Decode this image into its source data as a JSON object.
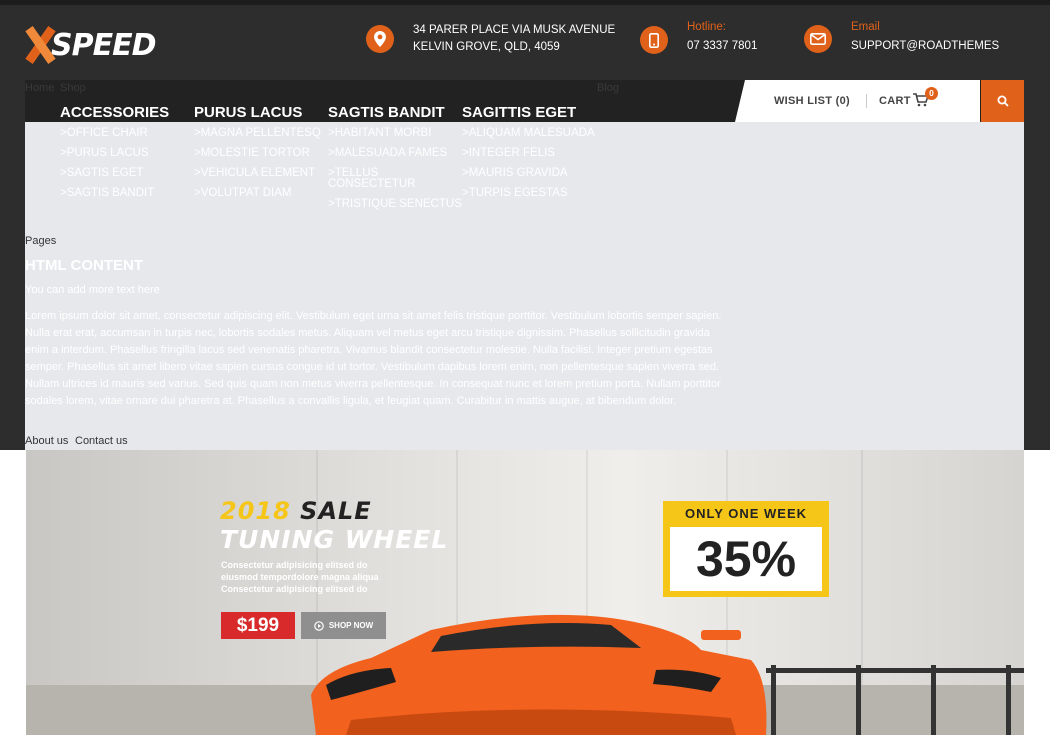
{
  "logo": {
    "text": "SPEED"
  },
  "contact": {
    "address_line1": "34 PARER PLACE VIA MUSK AVENUE",
    "address_line2": "KELVIN GROVE, QLD, 4059",
    "hotline_label": "Hotline:",
    "hotline_value": "07 3337 7801",
    "email_label": "Email",
    "email_value": "SUPPORT@ROADTHEMES"
  },
  "nav": {
    "home": "Home",
    "shop": "Shop",
    "blog": "Blog",
    "wishlist": "WISH LIST (0)",
    "cart": "CART",
    "cart_count": "0"
  },
  "menu": {
    "columns": [
      {
        "title": "ACCESSORIES",
        "items": [
          ">OFFICE CHAIR",
          ">PURUS LACUS",
          ">SAGTIS EGET",
          ">SAGTIS BANDIT"
        ]
      },
      {
        "title": "PURUS LACUS",
        "items": [
          ">MAGNA PELLENTESQ",
          ">MOLESTIE TORTOR",
          ">VEHICULA ELEMENT",
          ">VOLUTPAT DIAM"
        ]
      },
      {
        "title": "SAGTIS BANDIT",
        "items": [
          ">HABITANT MORBI",
          ">MALESUADA FAMES",
          ">TELLUS CONSECTETUR",
          ">TRISTIQUE SENECTUS"
        ]
      },
      {
        "title": "SAGITTIS EGET",
        "items": [
          ">ALIQUAM MALESUADA",
          ">INTEGER FELIS",
          ">MAURIS GRAVIDA",
          ">TURPIS EGESTAS"
        ]
      }
    ],
    "pages_label": "Pages",
    "html_title": "HTML CONTENT",
    "html_add": "You can add more text here",
    "lorem": "Lorem ipsum dolor sit amet, consectetur adipiscing elit. Vestibulum eget urna sit amet felis tristique porttitor. Vestibulum lobortis semper sapien. Nulla erat erat, accumsan in turpis nec, lobortis sodales metus. Aliquam vel metus eget arcu tristique dignissim. Phasellus sollicitudin gravida enim a interdum. Phasellus fringilla lacus sed venenatis pharetra. Vivamus blandit consectetur molestie. Nulla facilisi. Integer pretium egestas semper. Phasellus sit amet libero vitae sapien cursus congue id ut tortor. Vestibulum dapibus lorem enim, non pellentesque sapien viverra sed. Nullam ultrices id mauris sed varius. Sed quis quam non metus viverra pellentesque. In consequat nunc et lorem pretium porta. Nullam porttitor sodales lorem, vitae ornare dui pharetra at. Phasellus a convallis ligula, et feugiat quam. Curabitur in mattis augue, at bibendum dolor.",
    "about": "About us",
    "contact": "Contact us"
  },
  "banner": {
    "year": "2018",
    "sale": "SALE",
    "title": "TUNING WHEEL",
    "desc_line1": "Consectetur adipisicing elitsed do",
    "desc_line2": "eiusmod tempordolore magna aliqua",
    "desc_line3": "Consectetur adipisicing elitsed do",
    "price": "$199",
    "shop_now": "SHOP NOW",
    "week_label": "ONLY ONE WEEK",
    "discount": "35%"
  },
  "colors": {
    "accent": "#e0621a",
    "header_bg": "#2d2d2d",
    "yellow": "#f5c518",
    "price_red": "#d82a2a"
  }
}
